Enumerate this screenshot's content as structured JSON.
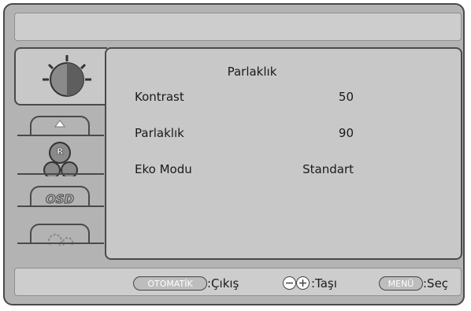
{
  "osd": {
    "tabs": [
      {
        "name": "picture",
        "icon": "brightness-knob-icon",
        "active": true
      },
      {
        "name": "position",
        "icon": "triangle-up-icon",
        "active": false
      },
      {
        "name": "color",
        "icon": "rgb-balls-icon",
        "active": false
      },
      {
        "name": "osd",
        "icon": "osd-text-icon",
        "active": false
      },
      {
        "name": "setup",
        "icon": "gears-icon",
        "active": false
      }
    ],
    "panel": {
      "title": "Parlaklık",
      "rows": [
        {
          "label": "Kontrast",
          "value": "50"
        },
        {
          "label": "Parlaklık",
          "value": "90"
        },
        {
          "label": "Eko Modu",
          "value": "Standart"
        }
      ]
    },
    "tab_labels": {
      "osd": "OSD",
      "color_r": "R"
    },
    "footer": {
      "auto_key": "OTOMATİK",
      "auto_action": ":Çıkış",
      "move_action": ":Taşı",
      "menu_key": "MENÜ",
      "menu_action": ":Seç"
    },
    "colors": {
      "frame": "#b3b3b3",
      "panel": "#c8c8c8",
      "border": "#4a4a4a"
    }
  }
}
